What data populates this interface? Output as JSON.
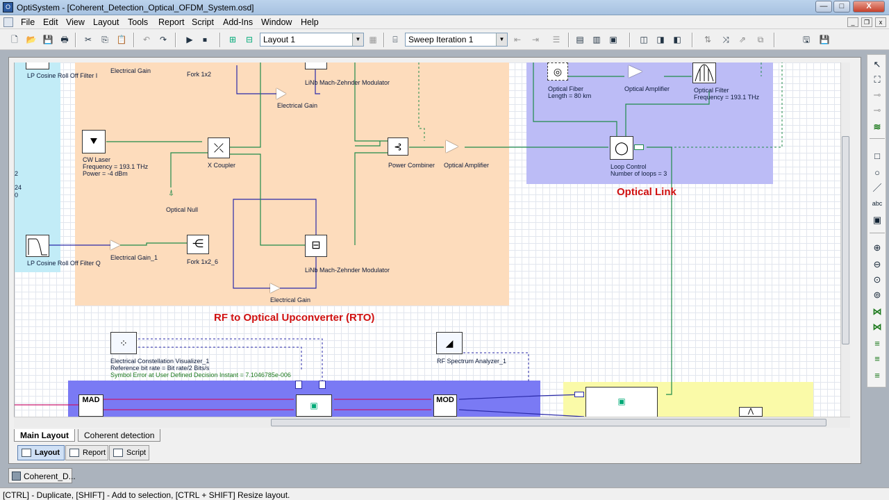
{
  "window": {
    "app_icon": "optisystem-app-icon",
    "title": "OptiSystem - [Coherent_Detection_Optical_OFDM_System.osd]",
    "minimize": "—",
    "maximize": "□",
    "close": "X"
  },
  "menu": {
    "items": [
      "File",
      "Edit",
      "View",
      "Layout",
      "Tools",
      "Report",
      "Script",
      "Add-Ins",
      "Window",
      "Help"
    ],
    "mdi_minimize": "_",
    "mdi_restore": "❐",
    "mdi_close": "x"
  },
  "toolbar": {
    "layout_combo": "Layout 1",
    "sweep_combo": "Sweep Iteration 1"
  },
  "canvas": {
    "regions": [
      {
        "name": "RF to Optical Upconverter (RTO)"
      },
      {
        "name": "Optical Link"
      }
    ],
    "components": {
      "lp_filter_i": "LP Cosine Roll Off Filter I",
      "elec_gain_top": "Electrical Gain",
      "fork_1x2": "Fork 1x2",
      "linb_mzm_top": "LiNb Mach-Zehnder Modulator",
      "elec_gain_mid": "Electrical Gain",
      "cw_laser_name": "CW Laser",
      "cw_laser_freq": "Frequency = 193.1  THz",
      "cw_laser_power": "Power = -4  dBm",
      "x_coupler": "X Coupler",
      "power_combiner": "Power Combiner",
      "optical_amp_1": "Optical Amplifier",
      "optical_null": "Optical Null",
      "lp_filter_q": "LP Cosine Roll Off Filter Q",
      "elec_gain_1": "Electrical Gain_1",
      "fork_1x2_6": "Fork 1x2_6",
      "linb_mzm_bottom": "LiNb Mach-Zehnder Modulator",
      "elec_gain_bottom": "Electrical Gain",
      "optical_fiber_name": "Optical Fiber",
      "optical_fiber_len": "Length = 80  km",
      "optical_amp_2": "Optical Amplifier",
      "optical_filter_name": "Optical Filter",
      "optical_filter_freq": "Frequency = 193.1  THz",
      "loop_control_name": "Loop Control",
      "loop_control_loops": "Number of loops = 3",
      "ecv_name": "Electrical Constellation Visualizer_1",
      "ecv_ref": "Reference bit rate = Bit rate/2  Bits/s",
      "ecv_ser": "Symbol Error at User Defined Decision Instant = 7.1046785e-006",
      "rf_spectrum": "RF Spectrum Analyzer_1",
      "mod_block": "MAD",
      "demod_block": "MOD",
      "left_frag_1": "2",
      "left_frag_2": "24",
      "left_frag_3": "0"
    }
  },
  "layout_tabs": [
    "Main Layout",
    "Coherent detection"
  ],
  "view_tabs": [
    "Layout",
    "Report",
    "Script"
  ],
  "taskbar": {
    "doc": "Coherent_D..."
  },
  "status": "[CTRL] - Duplicate, [SHIFT] - Add to selection, [CTRL + SHIFT] Resize layout."
}
